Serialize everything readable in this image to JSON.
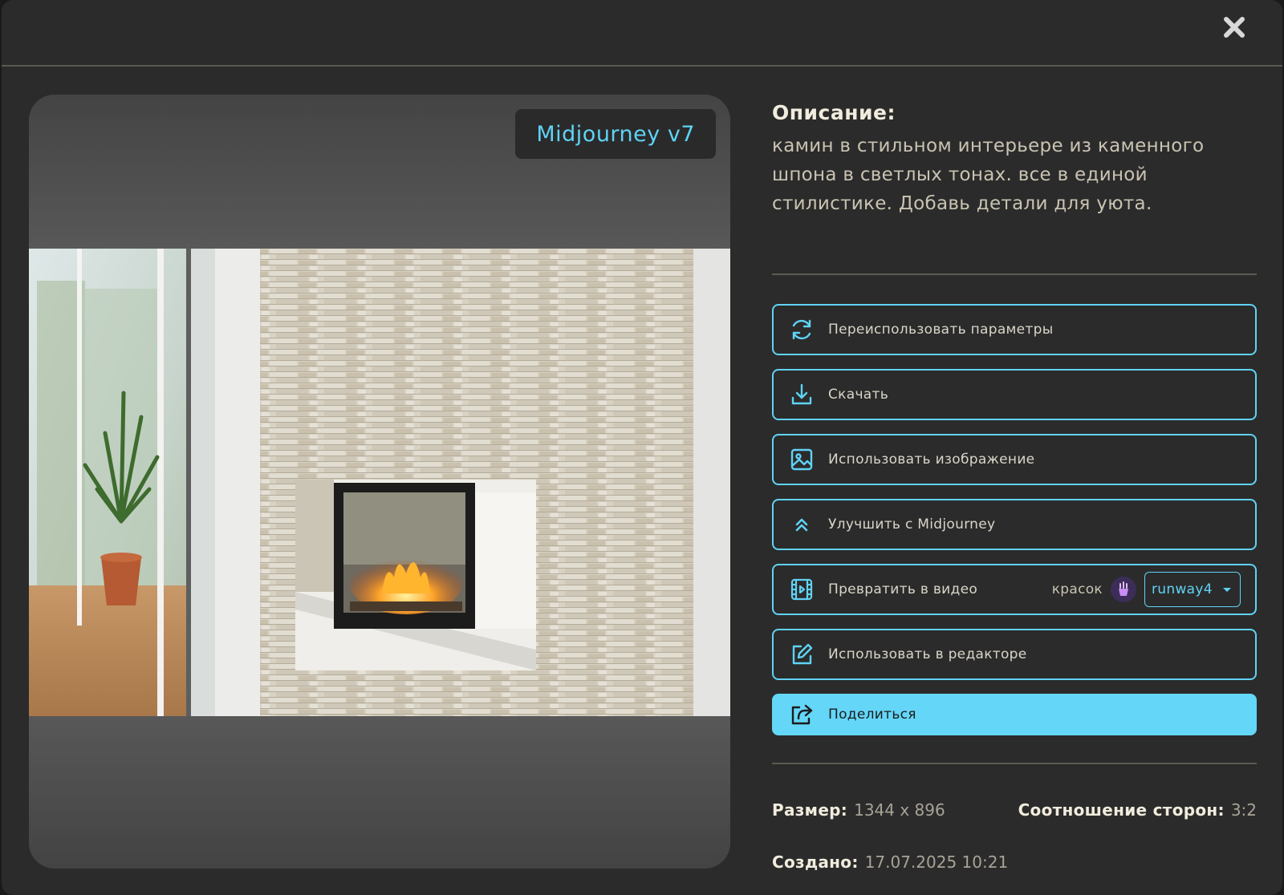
{
  "preview": {
    "model_badge": "Midjourney v7"
  },
  "description": {
    "title": "Описание:",
    "text": "камин в стильном интерьере из каменного шпона в светлых тонах. все в единой стилистике. Добавь детали для уюта."
  },
  "actions": {
    "reuse": "Переиспользовать параметры",
    "download": "Скачать",
    "use_image": "Использовать изображение",
    "improve": "Улучшить с Midjourney",
    "to_video": "Превратить в видео",
    "cost_label": "красок",
    "video_model": "runway4",
    "editor": "Использовать в редакторе",
    "share": "Поделиться"
  },
  "meta": {
    "size_label": "Размер:",
    "size_value": "1344 x 896",
    "ratio_label": "Соотношение сторон:",
    "ratio_value": "3:2",
    "created_label": "Создано:",
    "created_value": "17.07.2025 10:21"
  },
  "colors": {
    "accent": "#5fd3f5",
    "background": "#2b2b2b",
    "primary_button": "#64d6f8"
  },
  "icons": [
    "close-icon",
    "refresh-icon",
    "download-icon",
    "image-icon",
    "chevrons-up-icon",
    "video-icon",
    "paint-icon",
    "chevron-down-icon",
    "edit-icon",
    "share-icon"
  ]
}
